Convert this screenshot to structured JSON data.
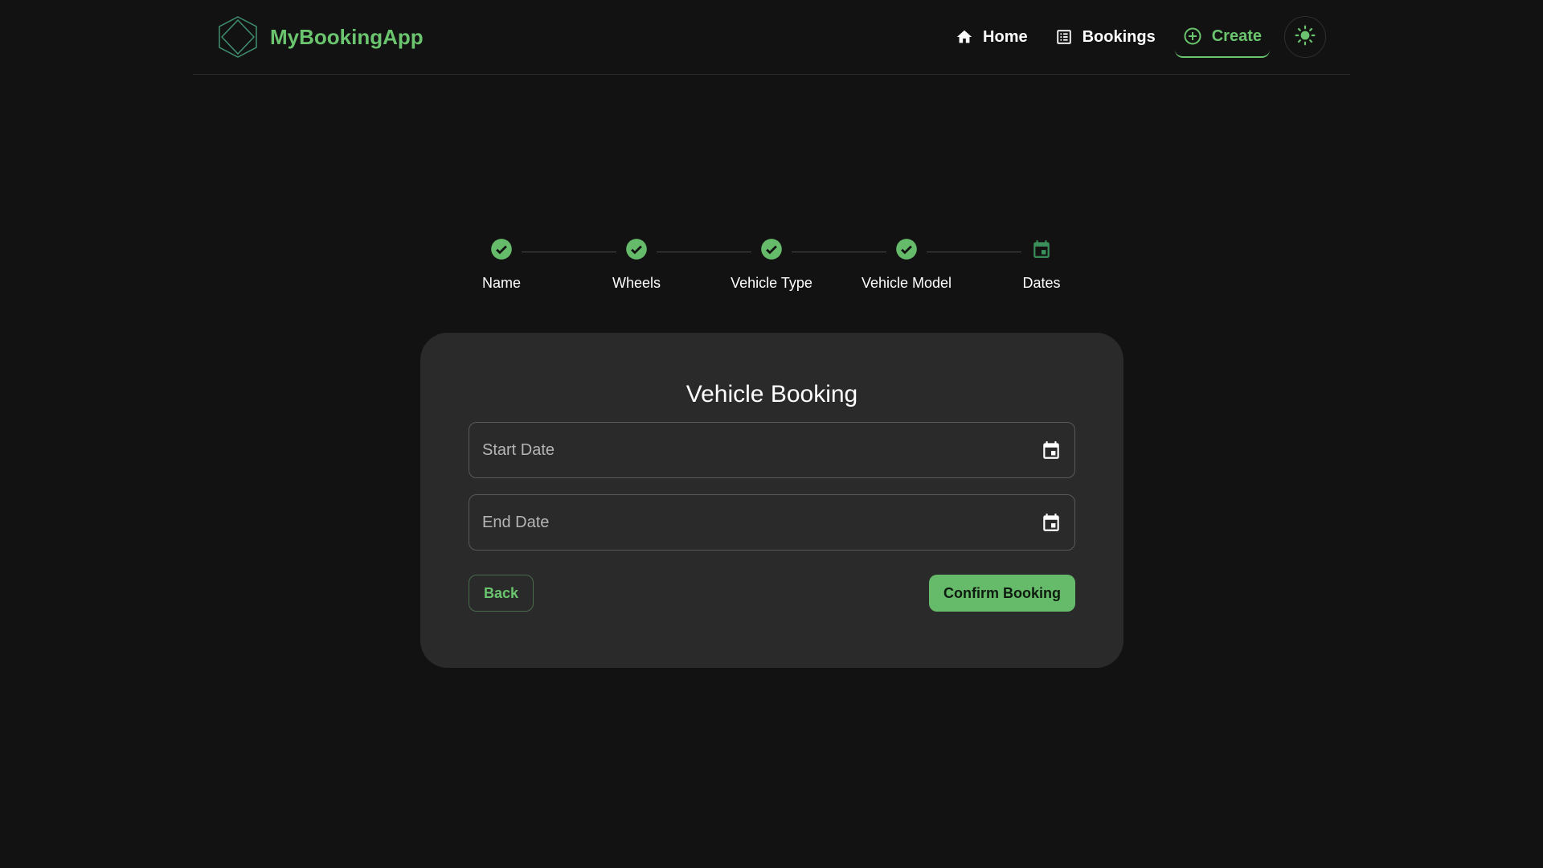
{
  "header": {
    "brand": {
      "name": "MyBookingApp",
      "logo_icon": "hexagon-cube-logo"
    },
    "nav": [
      {
        "label": "Home",
        "icon": "home-icon",
        "active": false
      },
      {
        "label": "Bookings",
        "icon": "list-icon",
        "active": false
      },
      {
        "label": "Create",
        "icon": "add-circle-icon",
        "active": true
      }
    ],
    "theme_toggle_icon": "sun-icon"
  },
  "stepper": {
    "steps": [
      {
        "label": "Name",
        "status": "completed"
      },
      {
        "label": "Wheels",
        "status": "completed"
      },
      {
        "label": "Vehicle Type",
        "status": "completed"
      },
      {
        "label": "Vehicle Model",
        "status": "completed"
      },
      {
        "label": "Dates",
        "status": "current"
      }
    ]
  },
  "form": {
    "title": "Vehicle Booking",
    "start_date": {
      "placeholder": "Start Date",
      "value": ""
    },
    "end_date": {
      "placeholder": "End Date",
      "value": ""
    },
    "back_label": "Back",
    "confirm_label": "Confirm Booking"
  },
  "colors": {
    "accent": "#66bb6a",
    "background": "#121212",
    "card": "#2a2a2a"
  }
}
